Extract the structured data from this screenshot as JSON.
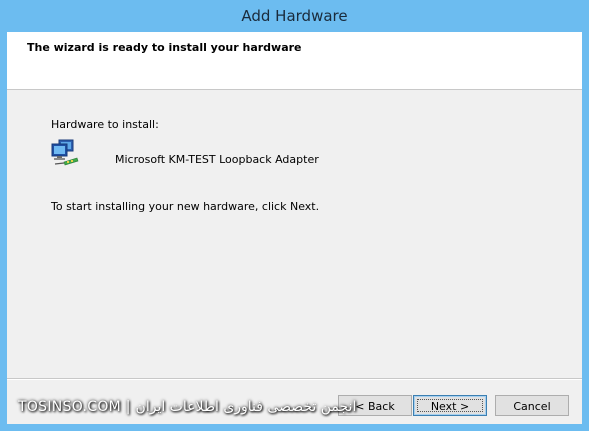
{
  "window": {
    "title": "Add Hardware"
  },
  "header": {
    "title": "The wizard is ready to install your hardware"
  },
  "body": {
    "hardware_label": "Hardware to install:",
    "device_name": "Microsoft KM-TEST Loopback Adapter",
    "instruction": "To start installing your new hardware, click Next.",
    "device_icon": "network-adapter-icon"
  },
  "buttons": {
    "back": "< Back",
    "next": "Next >",
    "cancel": "Cancel"
  },
  "watermark": {
    "text": "TOSINSO.COM | انجمن تخصصی فناوری اطلاعات ایران"
  }
}
